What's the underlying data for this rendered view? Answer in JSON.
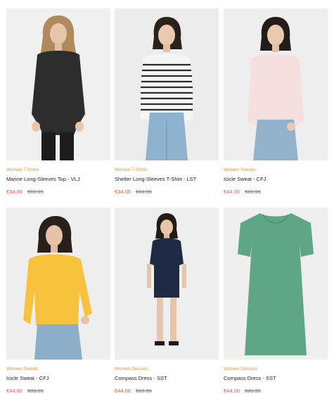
{
  "products": [
    {
      "category": "Women T-Shirts",
      "title": "Marine Long-Sleeves Top - VLJ",
      "price": "€34.00",
      "old_price": "€69.95",
      "image": "woman-black-longsleeve-photo"
    },
    {
      "category": "Women T-Shirts",
      "title": "Shelter Long-Sleeves T-Shirt - LST",
      "price": "€34.00",
      "old_price": "€69.95",
      "image": "woman-striped-longsleeve-photo"
    },
    {
      "category": "Women Sweats",
      "title": "Icicle Sweat - CFJ",
      "price": "€44.00",
      "old_price": "€89.95",
      "image": "woman-pink-sweat-photo"
    },
    {
      "category": "Women Sweats",
      "title": "Icicle Sweat - CFJ",
      "price": "€44.00",
      "old_price": "€89.95",
      "image": "woman-yellow-sweat-photo"
    },
    {
      "category": "Women Dresses",
      "title": "Compass Dress - SST",
      "price": "€44.00",
      "old_price": "€89.95",
      "image": "woman-navy-dress-photo"
    },
    {
      "category": "Women Dresses",
      "title": "Compass Dress - SST",
      "price": "€44.00",
      "old_price": "€89.95",
      "image": "green-dress-photo"
    }
  ],
  "colors": {
    "category": "#e0923a",
    "price": "#e45a3c",
    "old_price": "#777777",
    "image_bg": "#f1f1f1"
  }
}
